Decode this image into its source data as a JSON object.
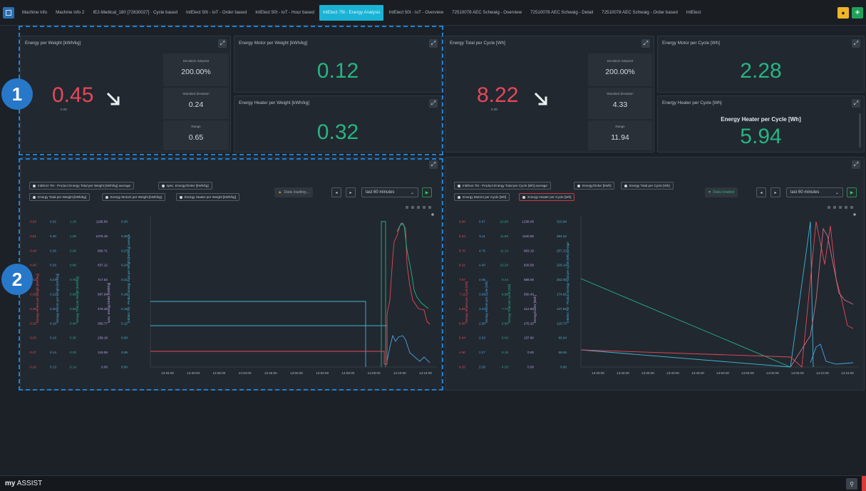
{
  "tabs": [
    {
      "label": "Machine info",
      "active": false
    },
    {
      "label": "Machine info 2",
      "active": false
    },
    {
      "label": "IE2-Medical_180 [72830027] · Cycle based",
      "active": false
    },
    {
      "label": "IntElect 50t - IoT - Order based",
      "active": false
    },
    {
      "label": "IntElect 50t - IoT - Hour based",
      "active": false
    },
    {
      "label": "IntElect 75t - Energy Analysis",
      "active": true
    },
    {
      "label": "IntElect 50t - IoT - Overview",
      "active": false
    },
    {
      "label": "72510078 AEC Schwaig - Overview",
      "active": false
    },
    {
      "label": "72510078 AEC Schwaig - Detail",
      "active": false
    },
    {
      "label": "72510078 AEC Schwaig - Order based",
      "active": false
    },
    {
      "label": "IntElect",
      "active": false
    }
  ],
  "colors": {
    "green": "#26b582",
    "red": "#e5485a",
    "accent": "#1ab3d6",
    "annotation": "#2778c8"
  },
  "badges": {
    "one": "1",
    "two": "2"
  },
  "kpi_left": {
    "title": "Energy per Weight [kWh/kg]",
    "value": "0.45",
    "subvalue": "0.00",
    "trend_icon": "arrow-down-right-icon",
    "stats": [
      {
        "label": "Deviation Setpoint",
        "value": "200.00%"
      },
      {
        "label": "Standard deviation",
        "value": "0.24"
      },
      {
        "label": "Range",
        "value": "0.65"
      }
    ]
  },
  "kpi_motor_weight": {
    "title": "Energy Motor per Weight [kWh/kg]",
    "value": "0.12"
  },
  "kpi_heater_weight": {
    "title": "Energy Heater per Weight [kWh/kg]",
    "value": "0.32"
  },
  "kpi_cycle": {
    "title": "Energy Total per Cycle [Wh]",
    "value": "8.22",
    "subvalue": "0.00",
    "trend_icon": "arrow-down-right-icon",
    "stats": [
      {
        "label": "Deviation Setpoint",
        "value": "200.00%"
      },
      {
        "label": "Standard deviation",
        "value": "4.33"
      },
      {
        "label": "Range",
        "value": "11.94"
      }
    ]
  },
  "kpi_motor_cycle": {
    "title": "Energy Motor per Cycle [Wh]",
    "value": "2.28"
  },
  "kpi_heater_cycle": {
    "title": "Energy Heater per Cycle [Wh]",
    "heading": "Energy Heater per Cycle [Wh]",
    "value": "5.94"
  },
  "chart_left": {
    "chips_row1": [
      "IntElect 75t - Product Energy Total per Weight [kWh/kg] average",
      "spec. Energy/Order [kWh/kg]"
    ],
    "chips_row2": [
      "Energy Total per Weight [kWh/kg]",
      "Energy Motors per Weight [kWh/kg]",
      "Energy Heater per Weight [kWh/kg]"
    ],
    "loading": "Data loading...",
    "range": "last 60 minutes",
    "axis_titles": [
      "Energy Heater per Weight [kWh/kg]",
      "Energy Motors per Weight [kWh/kg]",
      "Energy Total per Weight [kWh/kg]",
      "spec. Energy/Order [kWh/kg]",
      "IntElect 75t - Product Energy Total per Weight [kWh/kg] average"
    ],
    "axis_values": [
      [
        "0.54",
        "0.51",
        "0.48",
        "0.45",
        "0.42",
        "0.39",
        "0.36",
        "0.33",
        "0.30",
        "0.27",
        "0.24"
      ],
      [
        "0.32",
        "0.30",
        "0.28",
        "0.26",
        "0.24",
        "0.22",
        "0.20",
        "0.18",
        "0.16",
        "0.14",
        "0.13"
      ],
      [
        "1.16",
        "1.06",
        "0.96",
        "0.86",
        "0.76",
        "0.66",
        "0.56",
        "0.46",
        "0.36",
        "0.26",
        "0.14"
      ],
      [
        "1195.80",
        "1076.30",
        "956.71",
        "837.12",
        "717.53",
        "597.94",
        "478.35",
        "358.77",
        "239.18",
        "119.59",
        "0.00"
      ],
      [
        "0.33",
        "0.30",
        "0.27",
        "0.24",
        "0.21",
        "0.18",
        "0.15",
        "0.12",
        "0.09",
        "0.06",
        "0.00"
      ]
    ],
    "x_ticks": [
      "13:25:00",
      "13:30:00",
      "13:35:00",
      "13:40:00",
      "13:45:00",
      "13:50:00",
      "13:55:00",
      "14:00:00",
      "14:05:00",
      "14:10:00",
      "14:15:00"
    ]
  },
  "chart_right": {
    "chips_row1": [
      "IntElect 75t - Product Energy Total per Cycle [Wh] average",
      "Energy/Order [kWh]",
      "Energy Total per Cycle [Wh]"
    ],
    "chips_row2": [
      "Energy Motors per Cycle [Wh]",
      "Energy Heater per Cycle [Wh]"
    ],
    "loading": "Data loaded",
    "range": "last 60 minutes",
    "axis_titles": [
      "Energy Heater per Cycle [Wh]",
      "Energy Motors per Cycle [Wh]",
      "Energy Total per Cycle [Wh]",
      "Energy/Order [kWh]",
      "IntElect 75t - Product Energy Total per Cycle [Wh] average"
    ],
    "axis_values": [
      [
        "9.90",
        "9.34",
        "8.70",
        "8.22",
        "7.67",
        "7.11",
        "6.56",
        "6.00",
        "5.44",
        "4.90",
        "4.33"
      ],
      [
        "5.47",
        "5.11",
        "4.76",
        "4.40",
        "4.05",
        "3.69",
        "3.34",
        "2.98",
        "2.63",
        "2.27",
        "2.28"
      ],
      [
        "12.84",
        "11.90",
        "11.14",
        "10.29",
        "9.44",
        "8.58",
        "7.74",
        "6.89",
        "6.04",
        "5.19",
        "4.33"
      ],
      [
        "1238.00",
        "1100.80",
        "963.19",
        "826.59",
        "688.00",
        "550.40",
        "412.80",
        "275.20",
        "137.60",
        "0.00",
        "0.00"
      ],
      [
        "310.94",
        "284.32",
        "257.23",
        "229.14",
        "202.00",
        "174.91",
        "147.82",
        "120.73",
        "93.64",
        "66.55",
        "0.00"
      ]
    ],
    "x_ticks": [
      "13:25:00",
      "13:30:00",
      "13:35:00",
      "13:40:00",
      "13:45:00",
      "13:50:00",
      "13:55:00",
      "14:00:00",
      "14:05:00",
      "14:10:00",
      "14:15:00"
    ]
  },
  "footer": {
    "brand_prefix": "my",
    "brand_suffix": "ASSIST"
  }
}
